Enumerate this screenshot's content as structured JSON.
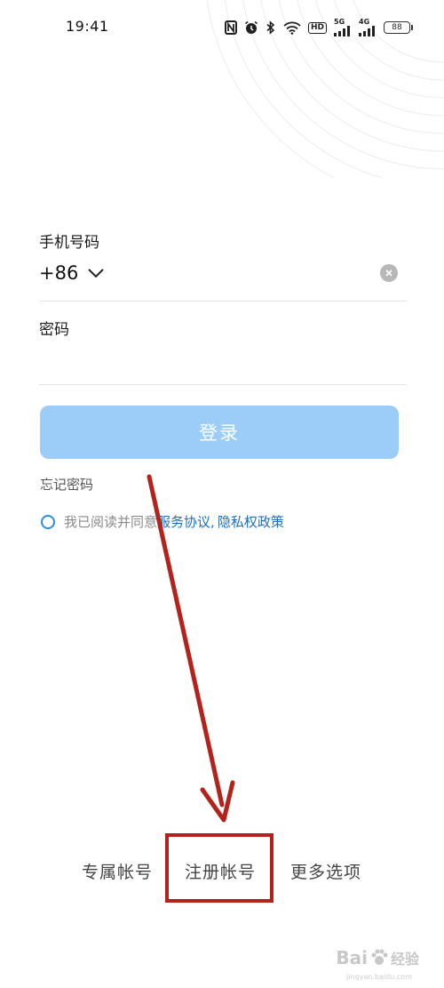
{
  "status_bar": {
    "time": "19:41",
    "icons": [
      "nfc-icon",
      "alarm-icon",
      "bluetooth-icon",
      "wifi-icon",
      "hd-icon",
      "signal-5g-icon",
      "signal-4g-icon",
      "battery-icon"
    ],
    "hd_label": "HD",
    "net1_label": "5G",
    "net2_label": "4G",
    "battery_level": "88"
  },
  "login_form": {
    "phone_label": "手机号码",
    "country_code": "+86",
    "password_label": "密码",
    "password_value": "",
    "login_button": "登录",
    "forgot_password": "忘记密码",
    "agreement_prefix": "我已阅读并同意",
    "terms_link": "服务协议",
    "separator": ",",
    "privacy_link": "隐私权政策"
  },
  "bottom_options": {
    "exclusive_account": "专属帐号",
    "register_account": "注册帐号",
    "more_options": "更多选项"
  },
  "watermark": {
    "brand": "Bai",
    "brand_suffix": "经验",
    "sub": "jingyan.baidu.com"
  },
  "colors": {
    "login_button": "#9ccdf8",
    "link": "#1e6fc1",
    "annotation_red": "#b3221b"
  }
}
